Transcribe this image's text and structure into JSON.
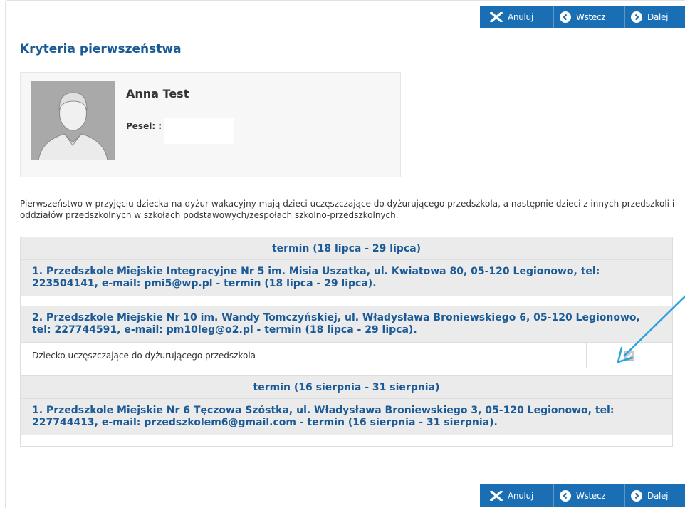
{
  "toolbar": {
    "cancel_label": "Anuluj",
    "back_label": "Wstecz",
    "next_label": "Dalej"
  },
  "page": {
    "title": "Kryteria pierwszeństwa"
  },
  "profile": {
    "name": "Anna Test",
    "pesel_label": "Pesel: :",
    "pesel_value": ""
  },
  "info_text": "Pierwszeństwo w przyjęciu dziecka na dyżur wakacyjny mają dzieci uczęszczające do dyżurującego przedszkola, a następnie dzieci z innych przedszkoli i oddziałów przedszkolnych w szkołach podstawowych/zespołach szkolno-przedszkolnych.",
  "terms": [
    {
      "header": "termin (18 lipca - 29 lipca)",
      "schools": [
        {
          "text": "1. Przedszkole Miejskie Integracyjne Nr 5 im. Misia Uszatka, ul. Kwiatowa 80, 05-120 Legionowo, tel: 223504141, e-mail: pmi5@wp.pl - termin (18 lipca - 29 lipca)."
        },
        {
          "text": "2. Przedszkole Miejskie Nr 10 im. Wandy Tomczyńskiej, ul. Władysława Broniewskiego 6, 05-120 Legionowo, tel: 227744591, e-mail: pm10leg@o2.pl - termin (18 lipca - 29 lipca).",
          "criterion": "Dziecko uczęszczające do dyżurującego przedszkola",
          "criterion_checked": true
        }
      ]
    },
    {
      "header": "termin (16 sierpnia - 31 sierpnia)",
      "schools": [
        {
          "text": "1. Przedszkole Miejskie Nr 6 Tęczowa Szóstka, ul. Władysława Broniewskiego 3, 05-120 Legionowo, tel: 227744413, e-mail: przedszkolem6@gmail.com - termin (16 sierpnia - 31 sierpnia)."
        }
      ]
    }
  ],
  "colors": {
    "accent": "#1a6eb4",
    "title": "#1a5a96",
    "annotation_arrow": "#29a3e0"
  }
}
